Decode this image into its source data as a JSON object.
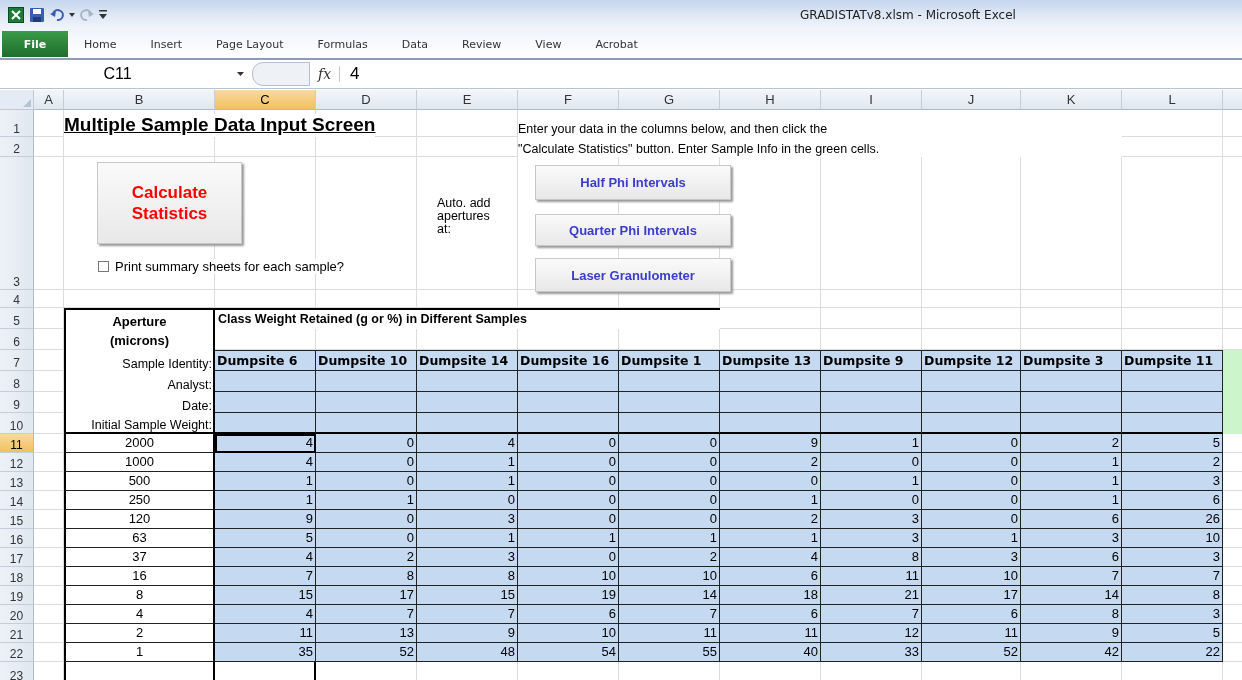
{
  "window": {
    "title": "GRADISTATv8.xlsm  -  Microsoft Excel"
  },
  "file_tab": "File",
  "ribbon_tabs": [
    "Home",
    "Insert",
    "Page Layout",
    "Formulas",
    "Data",
    "Review",
    "View",
    "Acrobat"
  ],
  "formula_bar": {
    "name_box": "C11",
    "function_label": "fx",
    "formula": "4"
  },
  "column_headers": [
    {
      "label": "A",
      "selected": false
    },
    {
      "label": "B",
      "selected": false
    },
    {
      "label": "C",
      "selected": true
    },
    {
      "label": "D",
      "selected": false
    },
    {
      "label": "E",
      "selected": false
    },
    {
      "label": "F",
      "selected": false
    },
    {
      "label": "G",
      "selected": false
    },
    {
      "label": "H",
      "selected": false
    },
    {
      "label": "I",
      "selected": false
    },
    {
      "label": "J",
      "selected": false
    },
    {
      "label": "K",
      "selected": false
    },
    {
      "label": "L",
      "selected": false
    }
  ],
  "row_headers": [
    {
      "label": "1",
      "selected": false
    },
    {
      "label": "2",
      "selected": false
    },
    {
      "label": "3",
      "selected": false
    },
    {
      "label": "4",
      "selected": false
    },
    {
      "label": "5",
      "selected": false
    },
    {
      "label": "6",
      "selected": false
    },
    {
      "label": "7",
      "selected": false
    },
    {
      "label": "8",
      "selected": false
    },
    {
      "label": "9",
      "selected": false
    },
    {
      "label": "10",
      "selected": false
    },
    {
      "label": "11",
      "selected": true
    },
    {
      "label": "12",
      "selected": false
    },
    {
      "label": "13",
      "selected": false
    },
    {
      "label": "14",
      "selected": false
    },
    {
      "label": "15",
      "selected": false
    },
    {
      "label": "16",
      "selected": false
    },
    {
      "label": "17",
      "selected": false
    },
    {
      "label": "18",
      "selected": false
    },
    {
      "label": "19",
      "selected": false
    },
    {
      "label": "20",
      "selected": false
    },
    {
      "label": "21",
      "selected": false
    },
    {
      "label": "22",
      "selected": false
    },
    {
      "label": "23",
      "selected": false
    }
  ],
  "sheet": {
    "title": "Multiple Sample Data Input Screen",
    "instructions": [
      "Enter your data in the columns below, and then click the",
      "\"Calculate Statistics\" button.  Enter Sample Info in the green cells."
    ],
    "calculate_button": "Calculate Statistics",
    "print_checkbox": {
      "label": "Print summary sheets for each sample?",
      "checked": false
    },
    "auto_add_label": "Auto. add apertures at:",
    "interval_buttons": [
      "Half Phi Intervals",
      "Quarter Phi Intervals",
      "Laser Granulometer"
    ],
    "aperture_header": "Aperture (microns)",
    "weight_header": "Class Weight Retained (g or %) in Different Samples",
    "meta_labels": [
      "Sample Identity:",
      "Analyst:",
      "Date:",
      "Initial Sample Weight:"
    ],
    "samples": [
      "Dumpsite 6",
      "Dumpsite 10",
      "Dumpsite 14",
      "Dumpsite 16",
      "Dumpsite 1",
      "Dumpsite 13",
      "Dumpsite 9",
      "Dumpsite 12",
      "Dumpsite 3",
      "Dumpsite 11"
    ],
    "rows": [
      {
        "aperture": "2000",
        "values": [
          "4",
          "0",
          "4",
          "0",
          "0",
          "9",
          "1",
          "0",
          "2",
          "5"
        ]
      },
      {
        "aperture": "1000",
        "values": [
          "4",
          "0",
          "1",
          "0",
          "0",
          "2",
          "0",
          "0",
          "1",
          "2"
        ]
      },
      {
        "aperture": "500",
        "values": [
          "1",
          "0",
          "1",
          "0",
          "0",
          "0",
          "1",
          "0",
          "1",
          "3"
        ]
      },
      {
        "aperture": "250",
        "values": [
          "1",
          "1",
          "0",
          "0",
          "0",
          "1",
          "0",
          "0",
          "1",
          "6"
        ]
      },
      {
        "aperture": "120",
        "values": [
          "9",
          "0",
          "3",
          "0",
          "0",
          "2",
          "3",
          "0",
          "6",
          "26"
        ]
      },
      {
        "aperture": "63",
        "values": [
          "5",
          "0",
          "1",
          "1",
          "1",
          "1",
          "3",
          "1",
          "3",
          "10"
        ]
      },
      {
        "aperture": "37",
        "values": [
          "4",
          "2",
          "3",
          "0",
          "2",
          "4",
          "8",
          "3",
          "6",
          "3"
        ]
      },
      {
        "aperture": "16",
        "values": [
          "7",
          "8",
          "8",
          "10",
          "10",
          "6",
          "11",
          "10",
          "7",
          "7"
        ]
      },
      {
        "aperture": "8",
        "values": [
          "15",
          "17",
          "15",
          "19",
          "14",
          "18",
          "21",
          "17",
          "14",
          "8"
        ]
      },
      {
        "aperture": "4",
        "values": [
          "4",
          "7",
          "7",
          "6",
          "7",
          "6",
          "7",
          "6",
          "8",
          "3"
        ]
      },
      {
        "aperture": "2",
        "values": [
          "11",
          "13",
          "9",
          "10",
          "11",
          "11",
          "12",
          "11",
          "9",
          "5"
        ]
      },
      {
        "aperture": "1",
        "values": [
          "35",
          "52",
          "48",
          "54",
          "55",
          "40",
          "33",
          "52",
          "42",
          "22"
        ]
      }
    ]
  }
}
